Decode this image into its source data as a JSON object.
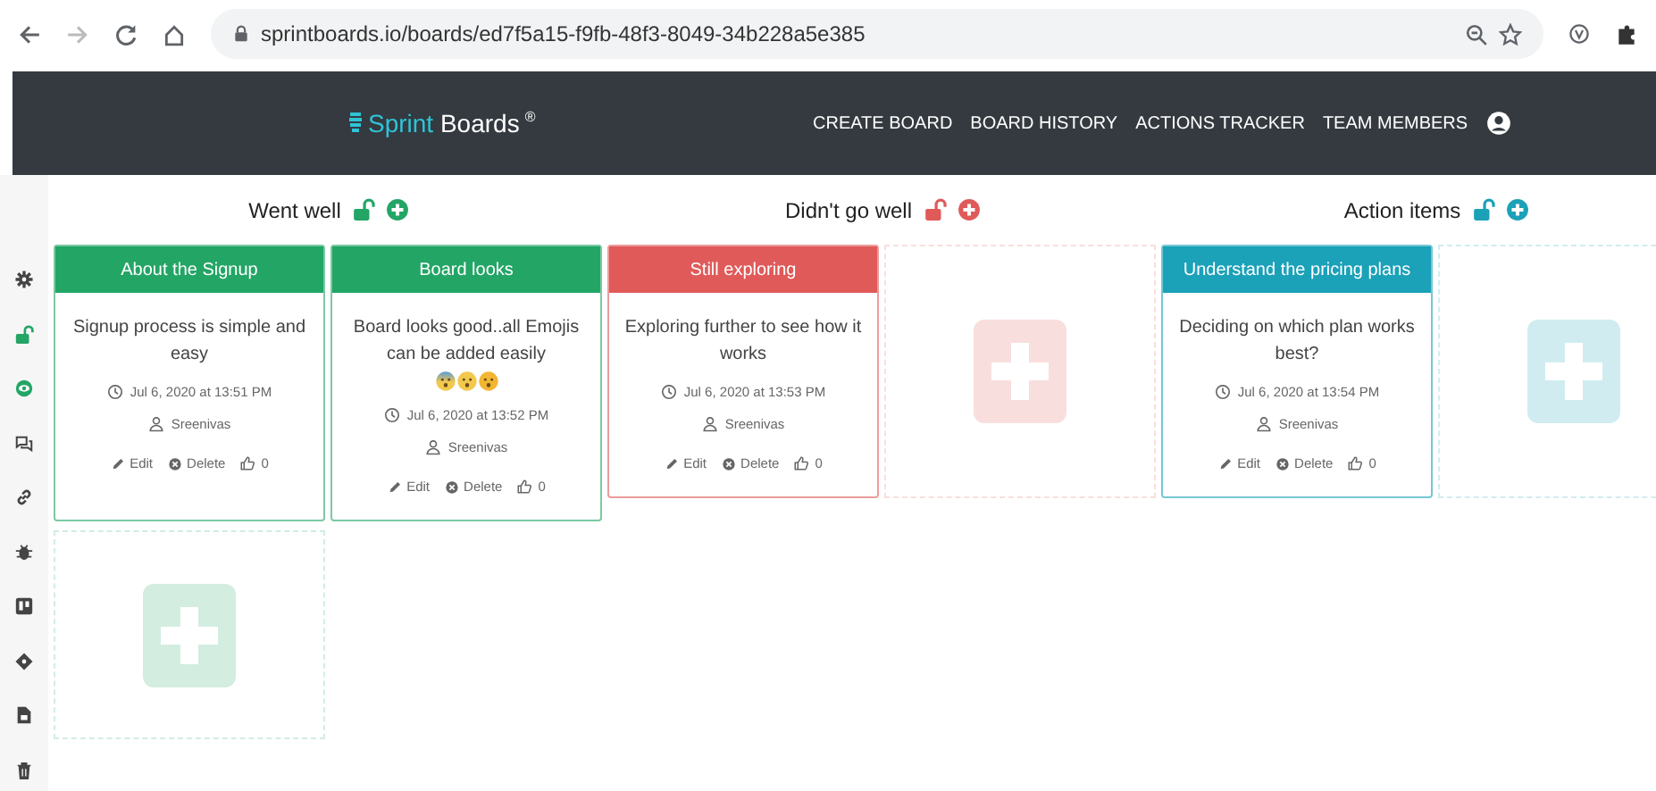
{
  "browser": {
    "url": "sprintboards.io/boards/ed7f5a15-f9fb-48f3-8049-34b228a5e385"
  },
  "nav": {
    "logo": {
      "first": "Sprint",
      "second": "Boards",
      "mark": "®"
    },
    "links": [
      "CREATE BOARD",
      "BOARD HISTORY",
      "ACTIONS TRACKER",
      "TEAM MEMBERS"
    ]
  },
  "sidebar": {
    "items": [
      {
        "kind": "gear",
        "active": false
      },
      {
        "kind": "unlock",
        "active": true
      },
      {
        "kind": "eye",
        "active": true
      },
      {
        "kind": "chat",
        "active": false
      },
      {
        "kind": "link",
        "active": false
      },
      {
        "kind": "bug",
        "active": false
      },
      {
        "kind": "board",
        "active": false
      },
      {
        "kind": "diamond",
        "active": false
      },
      {
        "kind": "file",
        "active": false
      },
      {
        "kind": "trash",
        "active": false
      }
    ]
  },
  "columns": [
    {
      "title": "Went well",
      "color": "#23a566",
      "cards": [
        {
          "title": "About the Signup",
          "text": "Signup process is simple and easy",
          "time": "Jul 6, 2020 at 13:51 PM",
          "author": "Sreenivas",
          "edit": "Edit",
          "delete": "Delete",
          "likes": "0"
        },
        {
          "title": "Board looks",
          "text": "Board looks good..all Emojis can be added easily",
          "emojis": [
            {
              "kind": "fearful"
            },
            {
              "kind": "astonished"
            },
            {
              "kind": "hushed"
            }
          ],
          "time": "Jul 6, 2020 at 13:52 PM",
          "author": "Sreenivas",
          "edit": "Edit",
          "delete": "Delete",
          "likes": "0"
        }
      ]
    },
    {
      "title": "Didn't go well",
      "color": "#e05a5a",
      "cards": [
        {
          "title": "Still exploring",
          "text": "Exploring further to see how it works",
          "time": "Jul 6, 2020 at 13:53 PM",
          "author": "Sreenivas",
          "edit": "Edit",
          "delete": "Delete",
          "likes": "0"
        }
      ]
    },
    {
      "title": "Action items",
      "color": "#1ba1b8",
      "cards": [
        {
          "title": "Understand the pricing plans",
          "text": "Deciding on which plan works best?",
          "time": "Jul 6, 2020 at 13:54 PM",
          "author": "Sreenivas",
          "edit": "Edit",
          "delete": "Delete",
          "likes": "0"
        }
      ]
    }
  ]
}
